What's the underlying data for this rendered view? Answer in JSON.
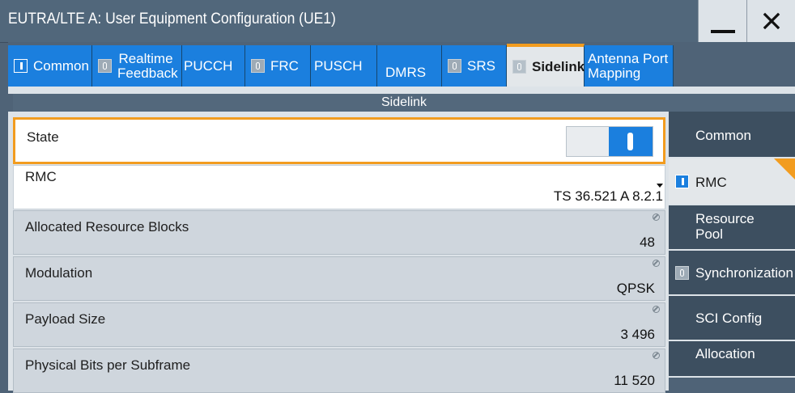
{
  "window": {
    "title": "EUTRA/LTE A: User Equipment Configuration (UE1)",
    "minimize_icon": "minimize-icon",
    "close_icon": "close-icon"
  },
  "tabs": [
    {
      "label": "Common",
      "toggle": "on"
    },
    {
      "label": "Realtime Feedback",
      "toggle": "off"
    },
    {
      "label": "PUCCH",
      "toggle": null
    },
    {
      "label": "FRC",
      "toggle": "off"
    },
    {
      "label": "PUSCH",
      "toggle": null
    },
    {
      "label": "DMRS",
      "toggle": null
    },
    {
      "label": "SRS",
      "toggle": "off"
    },
    {
      "label": "Sidelink",
      "toggle": "off",
      "active": true
    },
    {
      "label": "Antenna Port Mapping",
      "toggle": null
    }
  ],
  "section": {
    "title": "Sidelink"
  },
  "fields": {
    "state": {
      "label": "State",
      "value": "on"
    },
    "rmc": {
      "label": "RMC",
      "value": "TS 36.521  A 8.2.1"
    },
    "allocated_rb": {
      "label": "Allocated Resource Blocks",
      "value": "48"
    },
    "modulation": {
      "label": "Modulation",
      "value": "QPSK"
    },
    "payload_size": {
      "label": "Payload Size",
      "value": "3 496"
    },
    "physical_bits": {
      "label": "Physical Bits per Subframe",
      "value": "11 520"
    }
  },
  "sidenav": [
    {
      "label": "Common",
      "toggle": null
    },
    {
      "label": "RMC",
      "toggle": "on",
      "active": true
    },
    {
      "label": "Resource Pool",
      "toggle": null
    },
    {
      "label": "Synchronization",
      "toggle": "off"
    },
    {
      "label": "SCI Config",
      "toggle": null
    },
    {
      "label": "Allocation",
      "toggle": null
    }
  ],
  "colors": {
    "accent_orange": "#f29c1f",
    "accent_blue": "#1b7fde",
    "frame": "#4f6377",
    "panel": "#dde3e8"
  }
}
